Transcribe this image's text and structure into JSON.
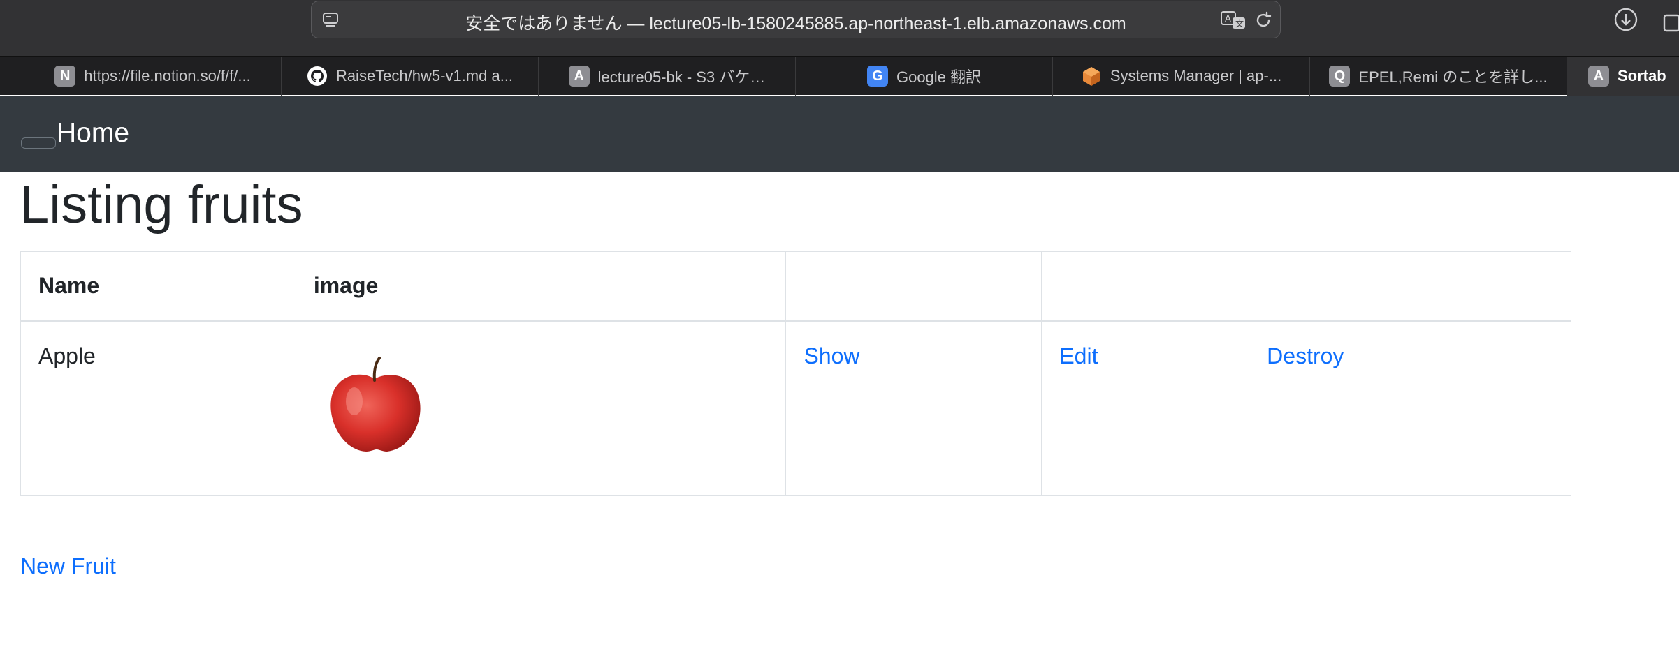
{
  "browser": {
    "url_text": "安全ではありません — lecture05-lb-1580245885.ap-northeast-1.elb.amazonaws.com",
    "tabs": [
      {
        "favicon": "N",
        "favicon_icon": "notion-icon",
        "label": "https://file.notion.so/f/f/..."
      },
      {
        "favicon": "",
        "favicon_icon": "github-icon",
        "label": "RaiseTech/hw5-v1.md a..."
      },
      {
        "favicon": "A",
        "favicon_icon": "letter-a-icon",
        "label": "lecture05-bk - S3 バケ…"
      },
      {
        "favicon": "G",
        "favicon_icon": "google-translate-icon",
        "label": "Google 翻訳"
      },
      {
        "favicon": "",
        "favicon_icon": "aws-systems-manager-icon",
        "label": "Systems Manager | ap-..."
      },
      {
        "favicon": "Q",
        "favicon_icon": "letter-q-icon",
        "label": "EPEL,Remi のことを詳し..."
      },
      {
        "favicon": "A",
        "favicon_icon": "letter-a-icon",
        "label": "Sortab"
      }
    ]
  },
  "navbar": {
    "home_label": "Home"
  },
  "page": {
    "title": "Listing fruits",
    "table": {
      "headers": [
        "Name",
        "image",
        "",
        "",
        ""
      ],
      "rows": [
        {
          "name": "Apple",
          "image_icon": "apple-image",
          "show_label": "Show",
          "edit_label": "Edit",
          "destroy_label": "Destroy"
        }
      ]
    },
    "new_link_label": "New Fruit"
  },
  "colors": {
    "navbar_bg": "#343a40",
    "link": "#0d6efd",
    "text": "#212529",
    "border": "#dee2e6"
  }
}
